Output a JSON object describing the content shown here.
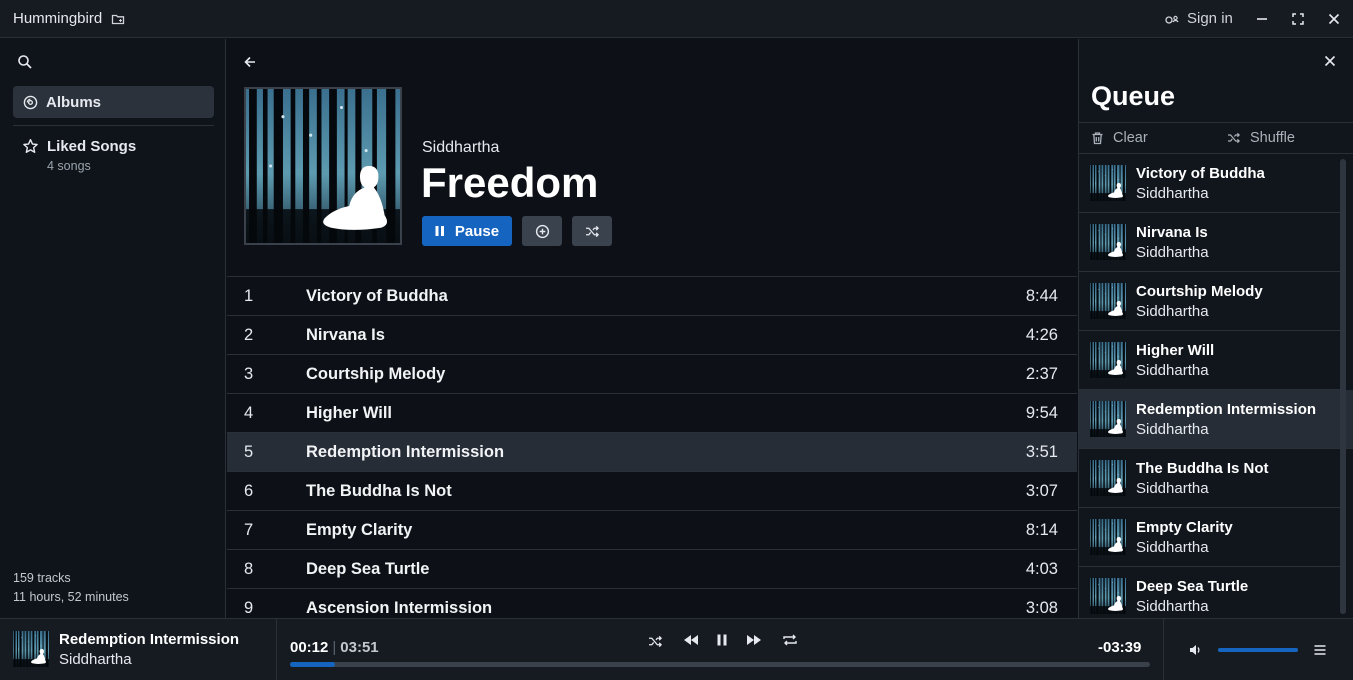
{
  "app": {
    "title": "Hummingbird",
    "sign_in": "Sign in"
  },
  "sidebar": {
    "albums_label": "Albums",
    "liked": {
      "title": "Liked Songs",
      "count": "4 songs"
    },
    "stats": {
      "tracks": "159 tracks",
      "duration": "11 hours, 52 minutes"
    }
  },
  "album": {
    "artist": "Siddhartha",
    "title": "Freedom",
    "pause_label": "Pause",
    "tracks": [
      {
        "num": "1",
        "title": "Victory of Buddha",
        "duration": "8:44"
      },
      {
        "num": "2",
        "title": "Nirvana Is",
        "duration": "4:26"
      },
      {
        "num": "3",
        "title": "Courtship Melody",
        "duration": "2:37"
      },
      {
        "num": "4",
        "title": "Higher Will",
        "duration": "9:54"
      },
      {
        "num": "5",
        "title": "Redemption Intermission",
        "duration": "3:51"
      },
      {
        "num": "6",
        "title": "The Buddha Is Not",
        "duration": "3:07"
      },
      {
        "num": "7",
        "title": "Empty Clarity",
        "duration": "8:14"
      },
      {
        "num": "8",
        "title": "Deep Sea Turtle",
        "duration": "4:03"
      },
      {
        "num": "9",
        "title": "Ascension Intermission",
        "duration": "3:08"
      }
    ]
  },
  "queue": {
    "title": "Queue",
    "clear_label": "Clear",
    "shuffle_label": "Shuffle",
    "items": [
      {
        "title": "Victory of Buddha",
        "artist": "Siddhartha"
      },
      {
        "title": "Nirvana Is",
        "artist": "Siddhartha"
      },
      {
        "title": "Courtship Melody",
        "artist": "Siddhartha"
      },
      {
        "title": "Higher Will",
        "artist": "Siddhartha"
      },
      {
        "title": "Redemption Intermission",
        "artist": "Siddhartha"
      },
      {
        "title": "The Buddha Is Not",
        "artist": "Siddhartha"
      },
      {
        "title": "Empty Clarity",
        "artist": "Siddhartha"
      },
      {
        "title": "Deep Sea Turtle",
        "artist": "Siddhartha"
      }
    ]
  },
  "player": {
    "title": "Redemption Intermission",
    "artist": "Siddhartha",
    "elapsed": "00:12",
    "total": "03:51",
    "remaining": "-03:39",
    "progress_fraction": 0.052,
    "volume_fraction": 1.0
  },
  "colors": {
    "accent": "#1565c0",
    "active_row": "#262d37",
    "background": "#0d1117"
  },
  "icons": [
    "folder-icon",
    "sign-in-icon",
    "minimize-icon",
    "maximize-icon",
    "close-icon",
    "search-icon",
    "albums-icon",
    "star-icon",
    "back-arrow-icon",
    "pause-icon",
    "add-circle-icon",
    "shuffle-icon",
    "trash-icon",
    "rewind-icon",
    "fast-forward-icon",
    "repeat-icon",
    "volume-icon",
    "menu-icon"
  ]
}
